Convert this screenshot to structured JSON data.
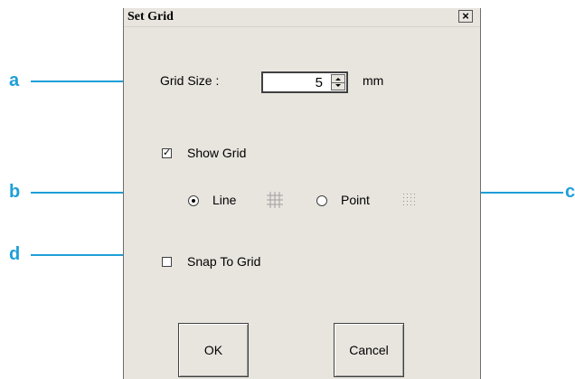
{
  "dialog": {
    "title": "Set Grid",
    "close_label": "×",
    "grid_size": {
      "label": "Grid Size :",
      "value": "5",
      "unit": "mm"
    },
    "show_grid": {
      "label": "Show Grid",
      "checked": true,
      "mark": "✓"
    },
    "line_option": {
      "label": "Line",
      "selected": true
    },
    "point_option": {
      "label": "Point",
      "selected": false
    },
    "snap_to_grid": {
      "label": "Snap To Grid",
      "checked": false
    },
    "ok_label": "OK",
    "cancel_label": "Cancel"
  },
  "callouts": {
    "a": "a",
    "b": "b",
    "c": "c",
    "d": "d",
    "color": "#1e9fd7"
  }
}
